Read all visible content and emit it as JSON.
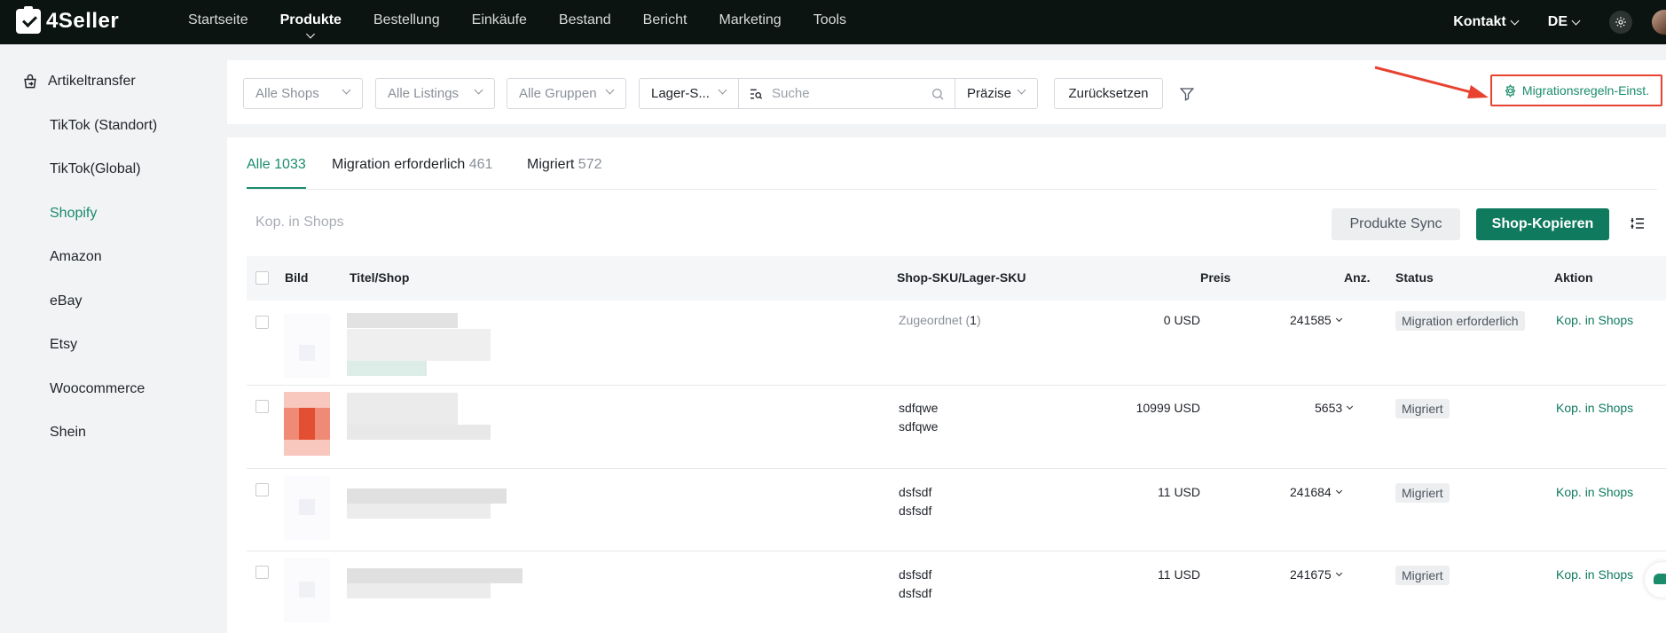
{
  "brand": {
    "name": "4Seller"
  },
  "nav": {
    "items": [
      "Startseite",
      "Produkte",
      "Bestellung",
      "Einkäufe",
      "Bestand",
      "Bericht",
      "Marketing",
      "Tools"
    ],
    "active": "Produkte"
  },
  "topbar": {
    "contact": "Kontakt",
    "language": "DE"
  },
  "sidebar": {
    "section_title": "Artikeltransfer",
    "items": [
      "TikTok (Standort)",
      "TikTok(Global)",
      "Shopify",
      "Amazon",
      "eBay",
      "Etsy",
      "Woocommerce",
      "Shein"
    ],
    "active": "Shopify"
  },
  "filters": {
    "shops": "Alle Shops",
    "listings": "Alle Listings",
    "groups": "Alle Gruppen",
    "search_type": "Lager-S...",
    "search_placeholder": "Suche",
    "match_mode": "Präzise",
    "reset": "Zurücksetzen",
    "migration_rules": "Migrationsregeln-Einst."
  },
  "tabs": [
    {
      "label": "Alle",
      "count": "1033"
    },
    {
      "label": "Migration erforderlich",
      "count": "461"
    },
    {
      "label": "Migriert",
      "count": "572"
    }
  ],
  "toolbar": {
    "bulk_action": "Kop. in Shops",
    "sync": "Produkte Sync",
    "copy": "Shop-Kopieren"
  },
  "table": {
    "headers": {
      "image": "Bild",
      "title": "Titel/Shop",
      "sku": "Shop-SKU/Lager-SKU",
      "price": "Preis",
      "qty": "Anz.",
      "status": "Status",
      "action": "Aktion"
    },
    "rows": [
      {
        "sku_prefix": "Zugeordnet (",
        "sku_count": "1",
        "sku_suffix": ")",
        "sku2": "",
        "price": "0 USD",
        "qty": "241585",
        "status": "Migration erforderlich",
        "action": "Kop. in Shops"
      },
      {
        "sku_prefix": "sdfqwe",
        "sku_count": "",
        "sku_suffix": "",
        "sku2": "sdfqwe",
        "price": "10999 USD",
        "qty": "5653",
        "status": "Migriert",
        "action": "Kop. in Shops"
      },
      {
        "sku_prefix": "dsfsdf",
        "sku_count": "",
        "sku_suffix": "",
        "sku2": "dsfsdf",
        "price": "11 USD",
        "qty": "241684",
        "status": "Migriert",
        "action": "Kop. in Shops"
      },
      {
        "sku_prefix": "dsfsdf",
        "sku_count": "",
        "sku_suffix": "",
        "sku2": "dsfsdf",
        "price": "11 USD",
        "qty": "241675",
        "status": "Migriert",
        "action": "Kop. in Shops"
      }
    ]
  },
  "colors": {
    "accent": "#0f7a5e",
    "highlight": "#e8412f",
    "topbar": "#0c1412"
  }
}
